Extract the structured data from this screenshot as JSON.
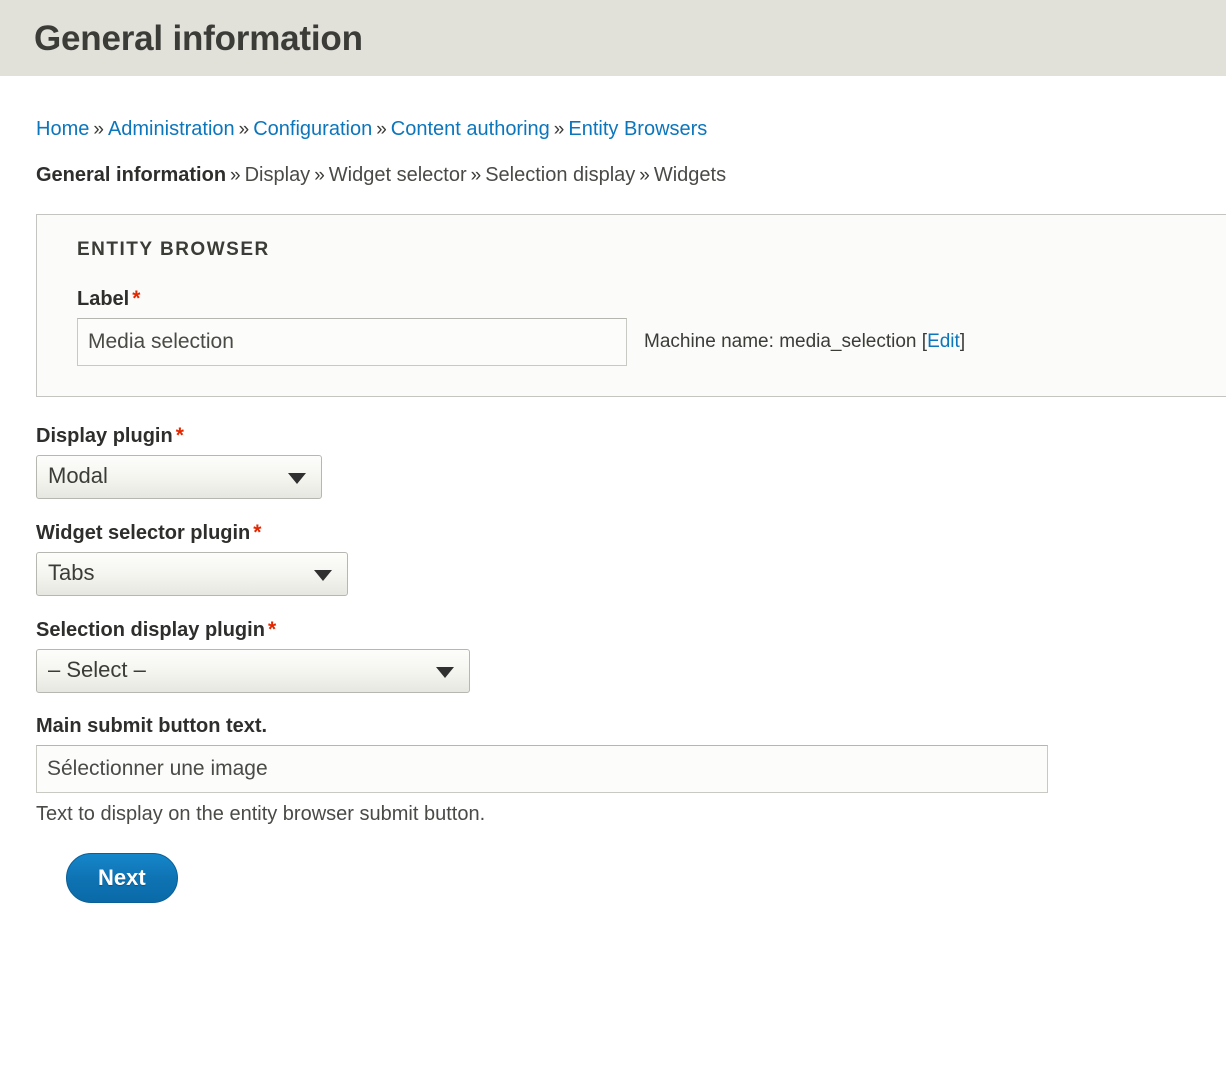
{
  "header": {
    "title": "General information"
  },
  "breadcrumb": {
    "separator": "»",
    "items": [
      {
        "label": "Home",
        "link": true
      },
      {
        "label": "Administration",
        "link": true
      },
      {
        "label": "Configuration",
        "link": true
      },
      {
        "label": "Content authoring",
        "link": true
      },
      {
        "label": "Entity Browsers",
        "link": true
      }
    ]
  },
  "steps": {
    "separator": "»",
    "items": [
      {
        "label": "General information",
        "current": true
      },
      {
        "label": "Display",
        "current": false
      },
      {
        "label": "Widget selector",
        "current": false
      },
      {
        "label": "Selection display",
        "current": false
      },
      {
        "label": "Widgets",
        "current": false
      }
    ]
  },
  "fieldset": {
    "legend": "ENTITY BROWSER",
    "label_field": {
      "label": "Label",
      "required_mark": "*",
      "value": "Media selection",
      "machine_name_prefix": "Machine name: ",
      "machine_name_value": "media_selection",
      "machine_name_bracket_open": " [",
      "machine_name_bracket_close": "]",
      "edit_link": "Edit"
    }
  },
  "form": {
    "display_plugin": {
      "label": "Display plugin",
      "required_mark": "*",
      "value": "Modal",
      "options": [
        "Modal"
      ]
    },
    "widget_selector_plugin": {
      "label": "Widget selector plugin",
      "required_mark": "*",
      "value": "Tabs",
      "options": [
        "Tabs"
      ]
    },
    "selection_display_plugin": {
      "label": "Selection display plugin",
      "required_mark": "*",
      "value": "– Select –",
      "options": [
        "– Select –"
      ]
    },
    "main_submit_button_text": {
      "label": "Main submit button text.",
      "value": "Sélectionner une image",
      "description": "Text to display on the entity browser submit button."
    }
  },
  "actions": {
    "next_label": "Next"
  },
  "colors": {
    "header_bg": "#e1e1da",
    "link_blue": "#0c76bc",
    "required_red": "#e32700",
    "button_blue": "#0e73b3",
    "fieldset_bg": "#fbfbf9",
    "text_dark": "#3b3b38"
  }
}
